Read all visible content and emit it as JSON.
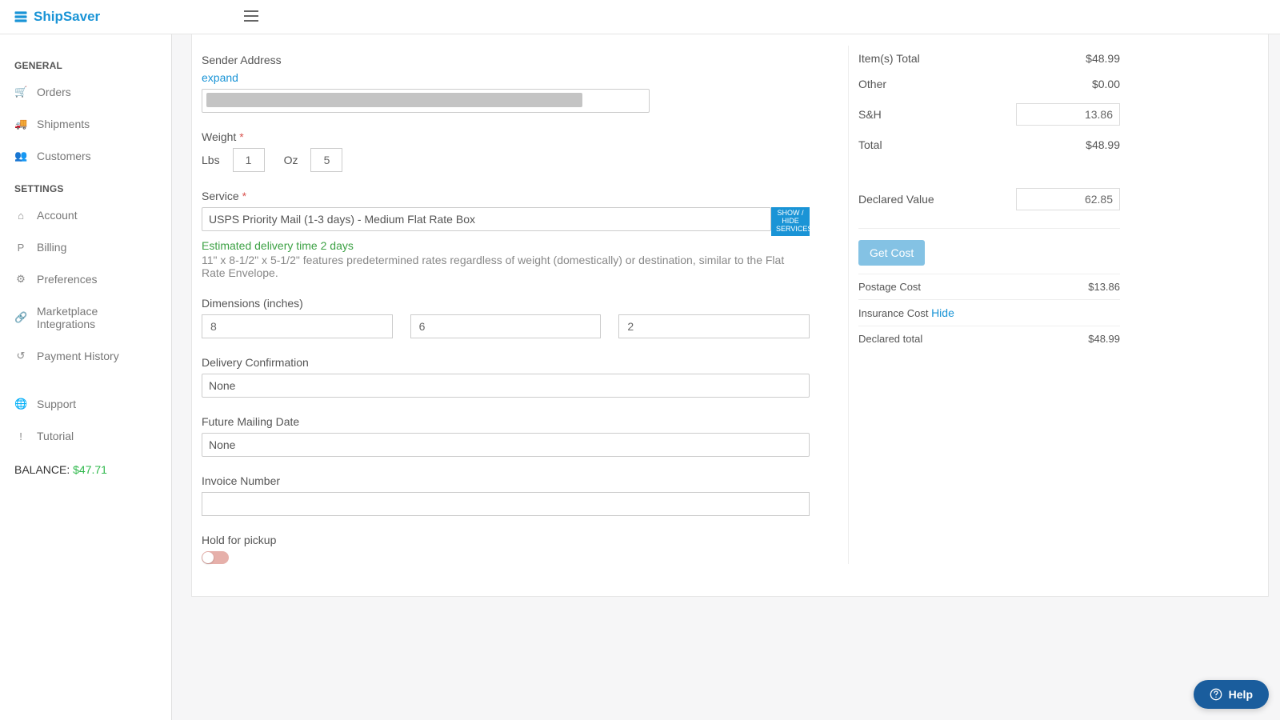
{
  "brand": {
    "name": "ShipSaver"
  },
  "sidebar": {
    "section_general": "GENERAL",
    "section_settings": "SETTINGS",
    "items_general": [
      {
        "label": "Orders",
        "icon": "🛒"
      },
      {
        "label": "Shipments",
        "icon": "🚚"
      },
      {
        "label": "Customers",
        "icon": "👥"
      }
    ],
    "items_settings": [
      {
        "label": "Account",
        "icon": "⌂"
      },
      {
        "label": "Billing",
        "icon": "P"
      },
      {
        "label": "Preferences",
        "icon": "⚙"
      },
      {
        "label": "Marketplace Integrations",
        "icon": "🔗"
      },
      {
        "label": "Payment History",
        "icon": "↺"
      }
    ],
    "items_lower": [
      {
        "label": "Support",
        "icon": "🌐"
      },
      {
        "label": "Tutorial",
        "icon": "!"
      }
    ],
    "balance_label": "BALANCE:",
    "balance_amount": "$47.71"
  },
  "form": {
    "sender_label": "Sender Address",
    "expand": "expand",
    "weight_label": "Weight",
    "lbs_label": "Lbs",
    "oz_label": "Oz",
    "lbs_value": "1",
    "oz_value": "5",
    "service_label": "Service",
    "service_value": "USPS Priority Mail (1-3 days) - Medium Flat Rate Box",
    "showhide": "SHOW / HIDE SERVICES",
    "estimate": "Estimated delivery time 2 days",
    "service_desc": "11\" x 8-1/2\" x 5-1/2\" features predetermined rates regardless of weight (domestically) or destination, similar to the Flat Rate Envelope.",
    "dims_label": "Dimensions (inches)",
    "dim_l": "8",
    "dim_w": "6",
    "dim_h": "2",
    "confirm_label": "Delivery Confirmation",
    "confirm_value": "None",
    "future_label": "Future Mailing Date",
    "future_value": "None",
    "invoice_label": "Invoice Number",
    "hold_label": "Hold for pickup"
  },
  "summary": {
    "items_total_label": "Item(s) Total",
    "items_total": "$48.99",
    "other_label": "Other",
    "other": "$0.00",
    "sh_label": "S&H",
    "sh": "13.86",
    "total_label": "Total",
    "total": "$48.99",
    "declared_label": "Declared Value",
    "declared": "62.85",
    "getcost": "Get Cost",
    "postage_label": "Postage Cost",
    "postage": "$13.86",
    "insurance_label": "Insurance Cost",
    "insurance_link": "Hide",
    "declared_total_label": "Declared total",
    "declared_total": "$48.99"
  },
  "help": {
    "label": "Help"
  }
}
